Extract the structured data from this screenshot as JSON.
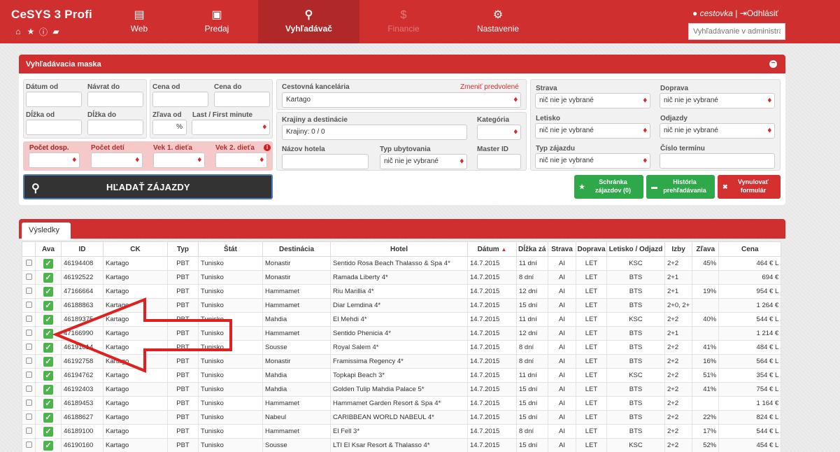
{
  "header": {
    "logo": "CeSYS 3 Profi",
    "nav": [
      {
        "label": "Web",
        "icon": "list-icon"
      },
      {
        "label": "Predaj",
        "icon": "briefcase-icon"
      },
      {
        "label": "Vyhľadávač",
        "icon": "search-icon",
        "active": true
      },
      {
        "label": "Financie",
        "icon": "dollar-icon",
        "disabled": true
      },
      {
        "label": "Nastavenie",
        "icon": "gear-icon"
      }
    ],
    "user": "cestovka",
    "separator": "|",
    "logout": "Odhlásiť",
    "admin_search_placeholder": "Vyhľadávanie v administrá"
  },
  "mask": {
    "title": "Vyhľadávacia maska",
    "labels": {
      "datum_od": "Dátum od",
      "navrat_do": "Návrat do",
      "dlzka_od": "Dĺžka od",
      "dlzka_do": "Dĺžka do",
      "cena_od": "Cena od",
      "cena_do": "Cena do",
      "zlava_od": "Zľava od",
      "last_first": "Last / First minute",
      "pocet_dosp": "Počet dosp.",
      "pocet_deti": "Počet detí",
      "vek1": "Vek 1. dieťa",
      "vek2": "Vek 2. dieťa",
      "ck": "Cestovná kancelária",
      "zmenit": "Zmeniť predvolené",
      "krajiny": "Krajiny a destinácie",
      "kategoria": "Kategória",
      "nazov_hotela": "Názov hotela",
      "typ_ubytovania": "Typ ubytovania",
      "master_id": "Master ID",
      "strava": "Strava",
      "doprava": "Doprava",
      "letisko": "Letisko",
      "odjazdy": "Odjazdy",
      "typ_zajazdu": "Typ zájazdu",
      "cislo_terminu": "Číslo termínu"
    },
    "values": {
      "zlava_unit": "%",
      "ck": "Kartago",
      "krajiny": "Krajiny: 0 / 0",
      "nic": "nič nie je vybrané"
    },
    "search_button": "HĽADAŤ ZÁJAZDY",
    "btn_schranka": "Schránka zájazdov (0)",
    "btn_historia": "História prehľadávania",
    "btn_vynulovat": "Vynulovať formulár"
  },
  "results": {
    "tab": "Výsledky",
    "columns": [
      "",
      "Ava",
      "ID",
      "CK",
      "Typ",
      "Štát",
      "Destinácia",
      "Hotel",
      "Dátum",
      "Dĺžka zá",
      "Strava",
      "Doprava",
      "Letisko / Odjazd",
      "Izby",
      "Zľava",
      "Cena"
    ],
    "rows": [
      {
        "id": "46194408",
        "ck": "Kartago",
        "typ": "PBT",
        "stat": "Tunisko",
        "dest": "Monastir",
        "hotel": "Sentido Rosa Beach Thalasso & Spa 4*",
        "datum": "14.7.2015",
        "dlzka": "11 dní",
        "strava": "AI",
        "doprava": "LET",
        "letisko": "KSC",
        "izby": "2+2",
        "zlava": "45%",
        "cena": "464 € L"
      },
      {
        "id": "46192522",
        "ck": "Kartago",
        "typ": "PBT",
        "stat": "Tunisko",
        "dest": "Monastir",
        "hotel": "Ramada Liberty  4*",
        "datum": "14.7.2015",
        "dlzka": "8 dní",
        "strava": "AI",
        "doprava": "LET",
        "letisko": "BTS",
        "izby": "2+1",
        "zlava": "",
        "cena": "694 €"
      },
      {
        "id": "47166664",
        "ck": "Kartago",
        "typ": "PBT",
        "stat": "Tunisko",
        "dest": "Hammamet",
        "hotel": "Riu Marillia 4*",
        "datum": "14.7.2015",
        "dlzka": "12 dní",
        "strava": "AI",
        "doprava": "LET",
        "letisko": "BTS",
        "izby": "2+1",
        "zlava": "19%",
        "cena": "954 € L"
      },
      {
        "id": "46188863",
        "ck": "Kartago",
        "typ": "PBT",
        "stat": "Tunisko",
        "dest": "Hammamet",
        "hotel": "Diar Lemdina 4*",
        "datum": "14.7.2015",
        "dlzka": "15 dní",
        "strava": "AI",
        "doprava": "LET",
        "letisko": "BTS",
        "izby": "2+0, 2+",
        "zlava": "",
        "cena": "1 264 €"
      },
      {
        "id": "46189375",
        "ck": "Kartago",
        "typ": "PBT",
        "stat": "Tunisko",
        "dest": "Mahdia",
        "hotel": "El Mehdi 4*",
        "datum": "14.7.2015",
        "dlzka": "11 dní",
        "strava": "AI",
        "doprava": "LET",
        "letisko": "KSC",
        "izby": "2+2",
        "zlava": "40%",
        "cena": "544 € L"
      },
      {
        "id": "47166990",
        "ck": "Kartago",
        "typ": "PBT",
        "stat": "Tunisko",
        "dest": "Hammamet",
        "hotel": "Sentido Phenicia  4*",
        "datum": "14.7.2015",
        "dlzka": "12 dní",
        "strava": "AI",
        "doprava": "LET",
        "letisko": "BTS",
        "izby": "2+1",
        "zlava": "",
        "cena": "1 214 €"
      },
      {
        "id": "46191014",
        "ck": "Kartago",
        "typ": "PBT",
        "stat": "Tunisko",
        "dest": "Sousse",
        "hotel": "Royal Salem 4*",
        "datum": "14.7.2015",
        "dlzka": "8 dní",
        "strava": "AI",
        "doprava": "LET",
        "letisko": "BTS",
        "izby": "2+2",
        "zlava": "41%",
        "cena": "484 € L"
      },
      {
        "id": "46192758",
        "ck": "Kartago",
        "typ": "PBT",
        "stat": "Tunisko",
        "dest": "Monastir",
        "hotel": "Framissima Regency 4*",
        "datum": "14.7.2015",
        "dlzka": "8 dní",
        "strava": "AI",
        "doprava": "LET",
        "letisko": "BTS",
        "izby": "2+2",
        "zlava": "16%",
        "cena": "564 € L"
      },
      {
        "id": "46194762",
        "ck": "Kartago",
        "typ": "PBT",
        "stat": "Tunisko",
        "dest": "Mahdia",
        "hotel": "Topkapi Beach 3*",
        "datum": "14.7.2015",
        "dlzka": "11 dní",
        "strava": "AI",
        "doprava": "LET",
        "letisko": "KSC",
        "izby": "2+2",
        "zlava": "51%",
        "cena": "354 € L"
      },
      {
        "id": "46192403",
        "ck": "Kartago",
        "typ": "PBT",
        "stat": "Tunisko",
        "dest": "Mahdia",
        "hotel": "Golden Tulip Mahdia Palace 5*",
        "datum": "14.7.2015",
        "dlzka": "15 dní",
        "strava": "AI",
        "doprava": "LET",
        "letisko": "BTS",
        "izby": "2+2",
        "zlava": "41%",
        "cena": "754 € L"
      },
      {
        "id": "46189453",
        "ck": "Kartago",
        "typ": "PBT",
        "stat": "Tunisko",
        "dest": "Hammamet",
        "hotel": "Hammamet Garden Resort & Spa 4*",
        "datum": "14.7.2015",
        "dlzka": "15 dní",
        "strava": "AI",
        "doprava": "LET",
        "letisko": "BTS",
        "izby": "2+2",
        "zlava": "",
        "cena": "1 164 €"
      },
      {
        "id": "46188627",
        "ck": "Kartago",
        "typ": "PBT",
        "stat": "Tunisko",
        "dest": "Nabeul",
        "hotel": "CARIBBEAN WORLD NABEUL 4*",
        "datum": "14.7.2015",
        "dlzka": "15 dní",
        "strava": "AI",
        "doprava": "LET",
        "letisko": "BTS",
        "izby": "2+2",
        "zlava": "22%",
        "cena": "824 € L"
      },
      {
        "id": "46189100",
        "ck": "Kartago",
        "typ": "PBT",
        "stat": "Tunisko",
        "dest": "Hammamet",
        "hotel": "El Fell 3*",
        "datum": "14.7.2015",
        "dlzka": "8 dní",
        "strava": "AI",
        "doprava": "LET",
        "letisko": "BTS",
        "izby": "2+2",
        "zlava": "17%",
        "cena": "544 € L"
      },
      {
        "id": "46190160",
        "ck": "Kartago",
        "typ": "PBT",
        "stat": "Tunisko",
        "dest": "Sousse",
        "hotel": "LTI El Ksar Resort & Thalasso 4*",
        "datum": "14.7.2015",
        "dlzka": "15 dní",
        "strava": "AI",
        "doprava": "LET",
        "letisko": "KSC",
        "izby": "2+2",
        "zlava": "52%",
        "cena": "454 € L"
      }
    ]
  },
  "colors": {
    "brand": "#d02f2f",
    "accent_dark": "#b02828",
    "green": "#2fa84a",
    "annotation_arrow": "#e02020"
  }
}
